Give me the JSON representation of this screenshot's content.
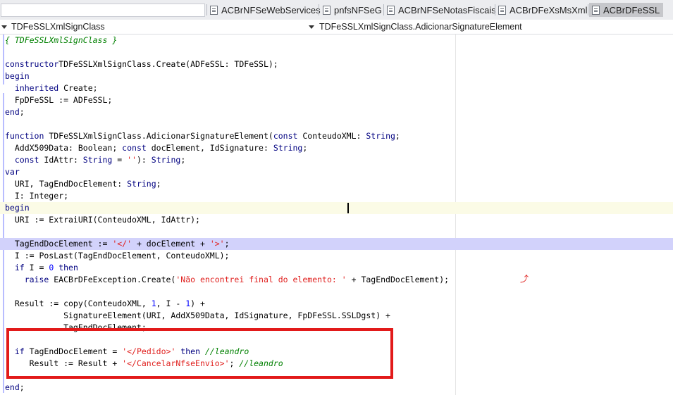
{
  "tabs": [
    {
      "label": "ACBrNFSeWebServices",
      "active": false
    },
    {
      "label": "pnfsNFSeG",
      "active": false
    },
    {
      "label": "ACBrNFSeNotasFiscais",
      "active": false
    },
    {
      "label": "ACBrDFeXsMsXml",
      "active": false
    },
    {
      "label": "ACBrDFeSSL",
      "active": true
    }
  ],
  "nav": {
    "class_selector": "TDFeSSLXmlSignClass",
    "method_selector": "TDFeSSLXmlSignClass.AdicionarSignatureElement"
  },
  "code": [
    {
      "tokens": [
        [
          "cmt",
          "{ TDFeSSLXmlSignClass }"
        ]
      ]
    },
    {
      "tokens": []
    },
    {
      "tokens": [
        [
          "kw",
          "constructor"
        ],
        [
          "",
          "TDFeSSLXmlSignClass.Create(ADFeSSL: TDFeSSL);"
        ]
      ]
    },
    {
      "tokens": [
        [
          "kw",
          "begin"
        ]
      ]
    },
    {
      "tokens": [
        [
          "",
          "  "
        ],
        [
          "kw",
          "inherited"
        ],
        [
          "",
          " Create;"
        ]
      ]
    },
    {
      "tokens": [
        [
          "",
          "  FpDFeSSL := ADFeSSL;"
        ]
      ]
    },
    {
      "tokens": [
        [
          "kw",
          "end"
        ],
        [
          "",
          ";"
        ]
      ]
    },
    {
      "tokens": []
    },
    {
      "tokens": [
        [
          "kw",
          "function"
        ],
        [
          "",
          " TDFeSSLXmlSignClass.AdicionarSignatureElement("
        ],
        [
          "kw",
          "const"
        ],
        [
          "",
          " ConteudoXML: "
        ],
        [
          "kw",
          "String"
        ],
        [
          "",
          ";"
        ]
      ]
    },
    {
      "tokens": [
        [
          "",
          "  AddX509Data: Boolean; "
        ],
        [
          "kw",
          "const"
        ],
        [
          "",
          " docElement, IdSignature: "
        ],
        [
          "kw",
          "String"
        ],
        [
          "",
          ";"
        ]
      ]
    },
    {
      "tokens": [
        [
          "",
          "  "
        ],
        [
          "kw",
          "const"
        ],
        [
          "",
          " IdAttr: "
        ],
        [
          "kw",
          "String"
        ],
        [
          "",
          " = "
        ],
        [
          "str",
          "''"
        ],
        [
          "",
          "): "
        ],
        [
          "kw",
          "String"
        ],
        [
          "",
          ";"
        ]
      ]
    },
    {
      "tokens": [
        [
          "kw",
          "var"
        ]
      ]
    },
    {
      "tokens": [
        [
          "",
          "  URI, TagEndDocElement: "
        ],
        [
          "kw",
          "String"
        ],
        [
          "",
          ";"
        ]
      ]
    },
    {
      "tokens": [
        [
          "",
          "  I: Integer;"
        ]
      ]
    },
    {
      "tokens": [
        [
          "kw",
          "begin"
        ]
      ],
      "highlight": "current"
    },
    {
      "tokens": [
        [
          "",
          "  URI := ExtraiURI(ConteudoXML, IdAttr);"
        ]
      ]
    },
    {
      "tokens": []
    },
    {
      "tokens": [
        [
          "",
          "  TagEndDocElement := "
        ],
        [
          "str",
          "'</'"
        ],
        [
          "",
          " + docElement + "
        ],
        [
          "str",
          "'>'"
        ],
        [
          "",
          ";"
        ]
      ],
      "highlight": "select"
    },
    {
      "tokens": [
        [
          "",
          "  I := PosLast(TagEndDocElement, ConteudoXML);"
        ]
      ]
    },
    {
      "tokens": [
        [
          "",
          "  "
        ],
        [
          "kw",
          "if"
        ],
        [
          "",
          " I = "
        ],
        [
          "num",
          "0"
        ],
        [
          "kw",
          " then"
        ]
      ]
    },
    {
      "tokens": [
        [
          "",
          "    "
        ],
        [
          "kw",
          "raise"
        ],
        [
          "",
          " EACBrDFeException.Create("
        ],
        [
          "str",
          "'Não encontrei final do elemento: '"
        ],
        [
          "",
          " + TagEndDocElement);"
        ]
      ]
    },
    {
      "tokens": []
    },
    {
      "tokens": [
        [
          "",
          "  Result := copy(ConteudoXML, "
        ],
        [
          "num",
          "1"
        ],
        [
          "",
          ", I - "
        ],
        [
          "num",
          "1"
        ],
        [
          "",
          ") +"
        ]
      ]
    },
    {
      "tokens": [
        [
          "",
          "            SignatureElement(URI, AddX509Data, IdSignature, FpDFeSSL.SSLDgst) +"
        ]
      ]
    },
    {
      "tokens": [
        [
          "",
          "            TagEndDocElement;"
        ]
      ]
    },
    {
      "tokens": []
    },
    {
      "tokens": [
        [
          "",
          "  "
        ],
        [
          "kw",
          "if"
        ],
        [
          "",
          " TagEndDocElement = "
        ],
        [
          "str",
          "'</Pedido>'"
        ],
        [
          "kw",
          " then"
        ],
        [
          "",
          " "
        ],
        [
          "cmt",
          "//leandro"
        ]
      ]
    },
    {
      "tokens": [
        [
          "",
          "     Result := Result + "
        ],
        [
          "str",
          "'</CancelarNfseEnvio>'"
        ],
        [
          "",
          "; "
        ],
        [
          "cmt",
          "//leandro"
        ]
      ]
    },
    {
      "tokens": []
    },
    {
      "tokens": [
        [
          "kw",
          "end"
        ],
        [
          "",
          ";"
        ]
      ]
    }
  ],
  "colors": {
    "keyword": "#000080",
    "string": "#e0201e",
    "number": "#0000ff",
    "comment": "#008000",
    "selection": "#d2d2fb",
    "current_line": "#fbfbe6",
    "annotation_box": "#e21a1a"
  },
  "icons": {
    "file_tab": "file-icon",
    "modified_undo": "undo-arrow-icon"
  }
}
